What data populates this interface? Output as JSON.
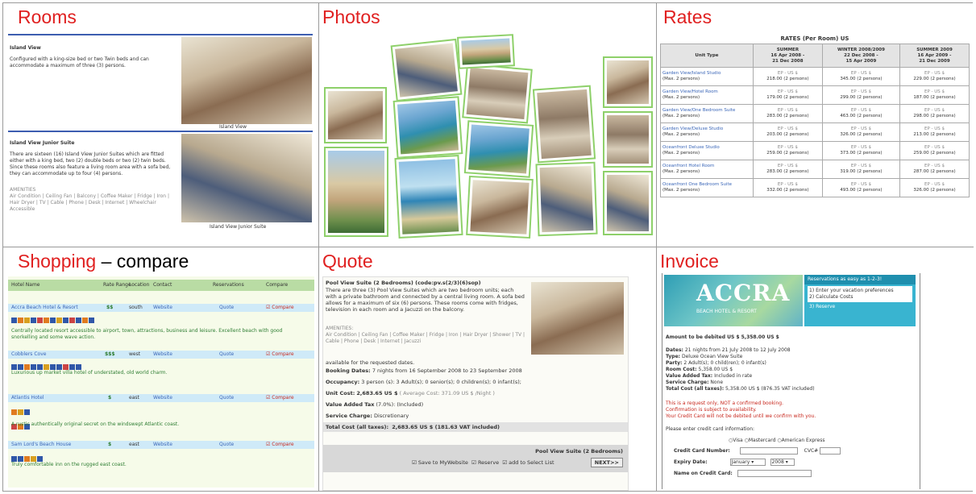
{
  "grid": {
    "cells": [
      {
        "key": "rooms",
        "title": "Rooms",
        "suffix": ""
      },
      {
        "key": "photos",
        "title": "Photos",
        "suffix": ""
      },
      {
        "key": "rates",
        "title": "Rates",
        "suffix": ""
      },
      {
        "key": "shopping",
        "title": "Shopping",
        "suffix": " – compare"
      },
      {
        "key": "quote",
        "title": "Quote",
        "suffix": ""
      },
      {
        "key": "invoice",
        "title": "Invoice",
        "suffix": ""
      }
    ]
  },
  "rooms": {
    "block1_title": "Island View",
    "block1_text": "Configured with a king-size bed or two Twin beds and can accommodate a maximum of three (3) persons.",
    "block1_caption": "Island View",
    "block2_title": "Island View Junior Suite",
    "block2_text": "There are sixteen (16) Island View Junior Suites which are fitted either with a king bed, two (2) double beds or two (2) twin beds. Since these rooms also feature a living room area with a sofa bed, they can accommodate up to four (4) persons.",
    "block2_amen_label": "AMENITIES",
    "block2_amen": "Air Condition | Ceiling Fan | Balcony | Coffee Maker | Fridge | Iron | Hair Dryer | TV | Cable | Phone | Desk | Internet | Wheelchair Accessible",
    "block2_caption": "Island View Junior Suite"
  },
  "rates": {
    "title": "RATES (Per Room) US",
    "headers": [
      "Unit Type",
      "SUMMER\n16 Apr 2008 -\n21 Dec 2008",
      "WINTER 2008/2009\n22 Dec 2008 -\n15 Apr 2009",
      "SUMMER 2009\n16 Apr 2009 -\n21 Dec 2009"
    ],
    "rows": [
      {
        "name": "Garden View/Island Studio",
        "max": "(Max. 2 persons)",
        "v": [
          "218.00 (2 persons)",
          "345.00 (2 persons)",
          "229.00 (2 persons)"
        ]
      },
      {
        "name": "Garden View/Hotel Room",
        "max": "(Max. 2 persons)",
        "v": [
          "179.00 (2 persons)",
          "299.00 (2 persons)",
          "187.00 (2 persons)"
        ]
      },
      {
        "name": "Garden View/One Bedroom Suite",
        "max": "(Max. 2 persons)",
        "v": [
          "283.00 (2 persons)",
          "463.00 (2 persons)",
          "298.00 (2 persons)"
        ]
      },
      {
        "name": "Garden View/Deluxe Studio",
        "max": "(Max. 2 persons)",
        "v": [
          "203.00 (2 persons)",
          "326.00 (2 persons)",
          "213.00 (2 persons)"
        ]
      },
      {
        "name": "Oceanfront Deluxe Studio",
        "max": "(Max. 2 persons)",
        "v": [
          "259.00 (2 persons)",
          "373.00 (2 persons)",
          "259.00 (2 persons)"
        ]
      },
      {
        "name": "Oceanfront Hotel Room",
        "max": "(Max. 2 persons)",
        "v": [
          "283.00 (2 persons)",
          "319.00 (2 persons)",
          "287.00 (2 persons)"
        ]
      },
      {
        "name": "Oceanfront One Bedroom Suite",
        "max": "(Max. 2 persons)",
        "v": [
          "332.00 (2 persons)",
          "493.00 (2 persons)",
          "326.00 (2 persons)"
        ]
      }
    ],
    "per": "EP - US $"
  },
  "shopping": {
    "cols": [
      "Hotel Name",
      "Rate Range",
      "Location",
      "Contact",
      "Reservations",
      "Compare"
    ],
    "hotels": [
      {
        "name": "Accra Beach Hotel & Resort",
        "rate": "$$",
        "loc": "south",
        "contact": "Website",
        "res": "Quote",
        "cmp": "Compare",
        "desc": "Centrally located resort accessible to airport, town, attractions, business and leisure. Excellent beach with good snorkelling and some wave action."
      },
      {
        "name": "Cobblers Cove",
        "rate": "$$$",
        "loc": "west",
        "contact": "Website",
        "res": "Quote",
        "cmp": "Compare",
        "desc": "Luxurious up market villa hotel of understated, old world charm."
      },
      {
        "name": "Atlantis Hotel",
        "rate": "$",
        "loc": "east",
        "contact": "Website",
        "res": "Quote",
        "cmp": "Compare",
        "desc": "A rustic authentically original secret on the windswept Atlantic coast."
      },
      {
        "name": "Sam Lord's Beach House",
        "rate": "$",
        "loc": "east",
        "contact": "Website",
        "res": "Quote",
        "cmp": "Compare",
        "desc": "Truly comfortable inn on the rugged east coast."
      }
    ]
  },
  "quote": {
    "title": "Pool View Suite (2 Bedrooms) (code:pv.s(2/3)(6)sop)",
    "desc": "There are three (3) Pool View Suites which are two bedroom units; each with a private bathroom and connected by a central living room. A sofa bed allows for a maximum of six (6) persons. These rooms come with fridges, television in each room and a Jacuzzi on the balcony.",
    "amen_label": "AMENITIES:",
    "amen": "Air Condition | Ceiling Fan | Coffee Maker | Fridge | Iron | Hair Dryer | Shower | TV | Cable | Phone | Desk | Internet | Jacuzzi",
    "avail": "available for the requested dates.",
    "booking_label": "Booking Dates:",
    "booking": "7 nights from 16 September 2008 to 23 September 2008",
    "occ_label": "Occupancy:",
    "occ": "3 person (s): 3 Adult(s); 0 senior(s); 0 children(s); 0 infant(s);",
    "unit_label": "Unit Cost:",
    "unit": "2,683.65 US $",
    "unit_note": "( Average Cost: 371.09 US $ /Night )",
    "vat_label": "Value Added Tax",
    "vat": "(7.0%): (Included)",
    "svc_label": "Service Charge:",
    "svc": "Discretionary",
    "total_label": "Total Cost (all taxes):",
    "total": "2,683.65 US $ (181.63 VAT included)",
    "footer_title": "Pool View Suite (2 Bedrooms)",
    "opt1": "Save to MyWebsite",
    "opt2": "Reserve",
    "opt3": "add to Select List",
    "next": "NEXT>>"
  },
  "invoice": {
    "logo": "ACCRA",
    "logo_sub": "BEACH HOTEL & RESORT",
    "steps_title": "Reservations as easy as 1-2-3!",
    "step1": "Enter your vacation preferences",
    "step2": "Calculate Costs",
    "step3": "Reserve",
    "total_head": "Amount to be debited US $ 5,358.00 US $",
    "l_dates": "Dates:",
    "dates": "21 nights from 21 July 2008 to 12 July 2008",
    "l_type": "Type:",
    "type": "Deluxe Ocean View Suite",
    "l_party": "Party:",
    "party": "2 Adult(s); 0 child(ren); 0 infant(s)",
    "l_room": "Room Cost:",
    "room": "5,358.00 US $",
    "l_vat": "Value Added Tax:",
    "vat": "Included in rate",
    "l_svc": "Service Charge:",
    "svc": "None",
    "l_total": "Total Cost (all taxes):",
    "total": "5,358.00 US $ (876.35 VAT included)",
    "warn1": "This is a request only, NOT a confirmed booking.",
    "warn2": "Confirmation is subject to availability.",
    "warn3": "Your Credit Card will not be debited until we confirm with you.",
    "cc_intro": "Please enter credit card information:",
    "cc_visa": "Visa",
    "cc_mc": "Mastercard",
    "cc_amex": "American Express",
    "l_ccnum": "Credit Card Number:",
    "l_cvc": "CVC#",
    "l_exp": "Expiry Date:",
    "exp_month": "January",
    "exp_year": "2008",
    "l_name": "Name on Credit Card:"
  }
}
